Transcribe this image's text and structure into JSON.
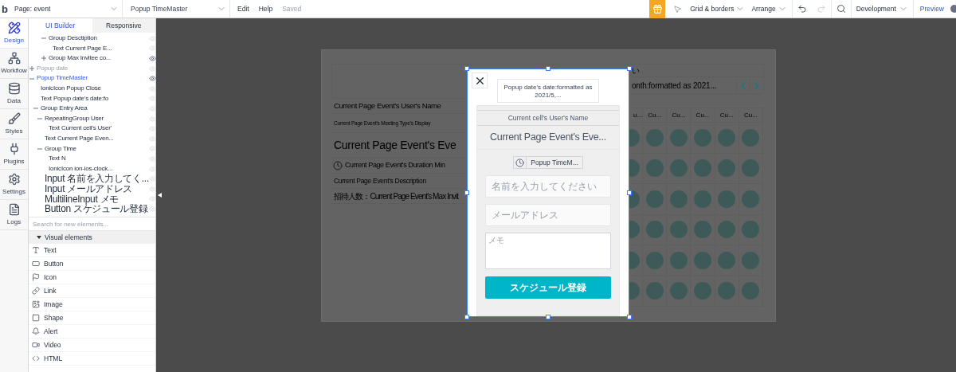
{
  "top_bar": {
    "logo": "b",
    "page_dropdown": "Page: event",
    "element_dropdown": "Popup TimeMaster",
    "menu": [
      {
        "label": "Edit",
        "disabled": false
      },
      {
        "label": "Help",
        "disabled": false
      },
      {
        "label": "Saved",
        "disabled": true
      }
    ],
    "grid_menu": "Grid & borders",
    "arrange_menu": "Arrange",
    "redo_disabled": true,
    "version_dropdown": "Development",
    "preview": "Preview"
  },
  "side_nav": [
    {
      "label": "Design",
      "selected": true
    },
    {
      "label": "Workflow",
      "selected": false
    },
    {
      "label": "Data",
      "selected": false
    },
    {
      "label": "Styles",
      "selected": false
    },
    {
      "label": "Plugins",
      "selected": false
    },
    {
      "label": "Settings",
      "selected": false
    },
    {
      "label": "Logs",
      "selected": false
    }
  ],
  "panel_tabs": [
    {
      "label": "UI Builder",
      "selected": true
    },
    {
      "label": "Responsive",
      "selected": false
    }
  ],
  "element_tree": {
    "continued_items": [
      {
        "label": "Group Desctiption",
        "expanded": true,
        "selected": false,
        "dimmed": false,
        "shown": false,
        "children": [
          {
            "label": "Text Current Page E...",
            "selected": false,
            "dimmed": false,
            "shown": false
          }
        ]
      },
      {
        "label": "Group Max Invitee co...",
        "expanded": false,
        "selected": false,
        "dimmed": false,
        "shown": true
      }
    ],
    "items": [
      {
        "label": "Popup date",
        "expanded": false,
        "selected": false,
        "dimmed": true,
        "shown": false
      },
      {
        "label": "Popup TimeMaster",
        "expanded": true,
        "selected": true,
        "dimmed": false,
        "shown": true,
        "children": [
          {
            "label": "IonicIcon Popup Close",
            "selected": false,
            "dimmed": false,
            "shown": false
          },
          {
            "label": "Text Popup date's date:fo",
            "selected": false,
            "dimmed": false,
            "shown": false
          },
          {
            "label": "Group Entry Area",
            "expanded": true,
            "selected": false,
            "dimmed": false,
            "shown": false,
            "children": [
              {
                "label": "RepeatingGroup User",
                "expanded": true,
                "selected": false,
                "dimmed": false,
                "shown": false,
                "children": [
                  {
                    "label": "Text Current cell's User'",
                    "selected": false,
                    "dimmed": false,
                    "shown": false
                  }
                ]
              },
              {
                "label": "Text Current Page Even...",
                "selected": false,
                "dimmed": false,
                "shown": false
              },
              {
                "label": "Group Time",
                "expanded": true,
                "selected": false,
                "dimmed": false,
                "shown": false,
                "children": [
                  {
                    "label": "Text N",
                    "selected": false,
                    "dimmed": false,
                    "shown": false
                  },
                  {
                    "label": "IonicIcon ion-ios-clock...",
                    "selected": false,
                    "dimmed": false,
                    "shown": false
                  }
                ]
              },
              {
                "label": "Input 名前を入力してく...",
                "selected": false,
                "dimmed": false,
                "shown": false
              },
              {
                "label": "Input メールアドレス",
                "selected": false,
                "dimmed": false,
                "shown": false
              },
              {
                "label": "MultilineInput メモ",
                "selected": false,
                "dimmed": false,
                "shown": false
              },
              {
                "label": "Button スケジュール登録",
                "selected": false,
                "dimmed": false,
                "shown": false
              }
            ]
          }
        ]
      }
    ]
  },
  "search": {
    "placeholder": "Search for new elements..."
  },
  "palette": {
    "title": "Visual elements",
    "expanded": true,
    "items": [
      {
        "kind": "text",
        "label": "Text"
      },
      {
        "kind": "button",
        "label": "Button"
      },
      {
        "kind": "icon",
        "label": "Icon"
      },
      {
        "kind": "link",
        "label": "Link"
      },
      {
        "kind": "image",
        "label": "Image"
      },
      {
        "kind": "shape",
        "label": "Shape"
      },
      {
        "kind": "alert",
        "label": "Alert"
      },
      {
        "kind": "video",
        "label": "Video"
      },
      {
        "kind": "html",
        "label": "HTML"
      }
    ]
  },
  "page": {
    "left_rows": [
      {
        "kind": "name",
        "text": "Current Page Event's User's Name"
      },
      {
        "kind": "small",
        "text": "Current Page Event's Meeting Type's Display"
      },
      {
        "kind": "title",
        "text": "Current Page Event's Eve"
      },
      {
        "kind": "duration",
        "text": "Current Page Event's Duration Min"
      },
      {
        "kind": "plain",
        "text": "Current Page Event's Description"
      },
      {
        "kind": "count",
        "text": "招待人数：Current Page Event's Max Invit"
      }
    ],
    "calendar": {
      "header_fragment": "い",
      "month": "onth:formatted as 2021...",
      "columns": [
        "u...",
        "Cu...",
        "Cu...",
        "Cu...",
        "Cu...",
        "Cu..."
      ]
    }
  },
  "popup": {
    "date": "Popup date's date:formatted as 2021/5,...",
    "user_name": "Current cell's User's Name",
    "event_title": "Current Page Event's Eve...",
    "time": "Popup TimeM...",
    "name_placeholder": "名前を入力してください",
    "email_placeholder": "メールアドレス",
    "memo_placeholder": "メモ",
    "submit": "スケジュール登録"
  }
}
